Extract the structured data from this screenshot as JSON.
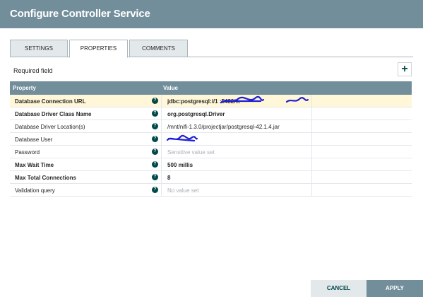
{
  "dialog": {
    "title": "Configure Controller Service"
  },
  "tabs": [
    {
      "label": "SETTINGS",
      "active": false
    },
    {
      "label": "PROPERTIES",
      "active": true
    },
    {
      "label": "COMMENTS",
      "active": false
    }
  ],
  "required_field_label": "Required field",
  "add_button_label": "+",
  "table": {
    "headers": {
      "property": "Property",
      "value": "Value"
    },
    "rows": [
      {
        "name": "Database Connection URL",
        "value": "jdbc:postgresql://1  :5432/...",
        "required": true,
        "selected": true,
        "placeholder": false
      },
      {
        "name": "Database Driver Class Name",
        "value": "org.postgresql.Driver",
        "required": true,
        "selected": false,
        "placeholder": false
      },
      {
        "name": "Database Driver Location(s)",
        "value": "/mnt/nifi-1.3.0/projectjar/postgresql-42.1.4.jar",
        "required": false,
        "selected": false,
        "placeholder": false
      },
      {
        "name": "Database User",
        "value": "",
        "required": false,
        "selected": false,
        "placeholder": false
      },
      {
        "name": "Password",
        "value": "Sensitive value set",
        "required": false,
        "selected": false,
        "placeholder": true
      },
      {
        "name": "Max Wait Time",
        "value": "500 millis",
        "required": true,
        "selected": false,
        "placeholder": false
      },
      {
        "name": "Max Total Connections",
        "value": "8",
        "required": true,
        "selected": false,
        "placeholder": false
      },
      {
        "name": "Validation query",
        "value": "No value set",
        "required": false,
        "selected": false,
        "placeholder": true
      }
    ]
  },
  "help_icon_glyph": "?",
  "footer": {
    "cancel_label": "CANCEL",
    "apply_label": "APPLY"
  },
  "colors": {
    "header": "#728e9b",
    "accent": "#004849",
    "selected_row": "#fff7d7",
    "redaction": "#1f1fd6"
  }
}
